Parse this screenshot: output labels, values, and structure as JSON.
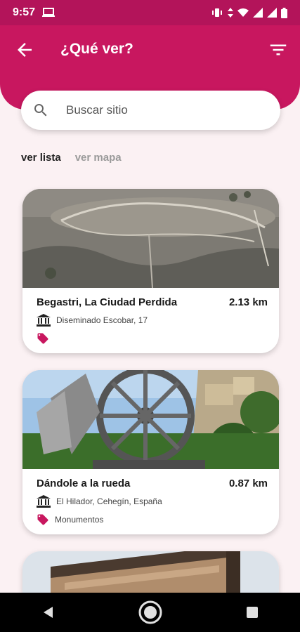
{
  "status_bar": {
    "time": "9:57"
  },
  "header": {
    "title": "¿Qué ver?"
  },
  "search": {
    "placeholder": "Buscar sitio"
  },
  "tabs": {
    "list": "ver lista",
    "map": "ver mapa"
  },
  "places": [
    {
      "title": "Begastri, La Ciudad Perdida",
      "distance": "2.13 km",
      "address": "Diseminado Escobar, 17",
      "category": ""
    },
    {
      "title": "Dándole a la rueda",
      "distance": "0.87 km",
      "address": "El Hilador, Cehegín, España",
      "category": "Monumentos"
    }
  ],
  "colors": {
    "primary": "#c8175f",
    "status_bar": "#b3145a",
    "background": "#fbf1f3"
  },
  "icons": [
    "back-arrow-icon",
    "filter-icon",
    "search-icon",
    "museum-icon",
    "tag-icon"
  ]
}
